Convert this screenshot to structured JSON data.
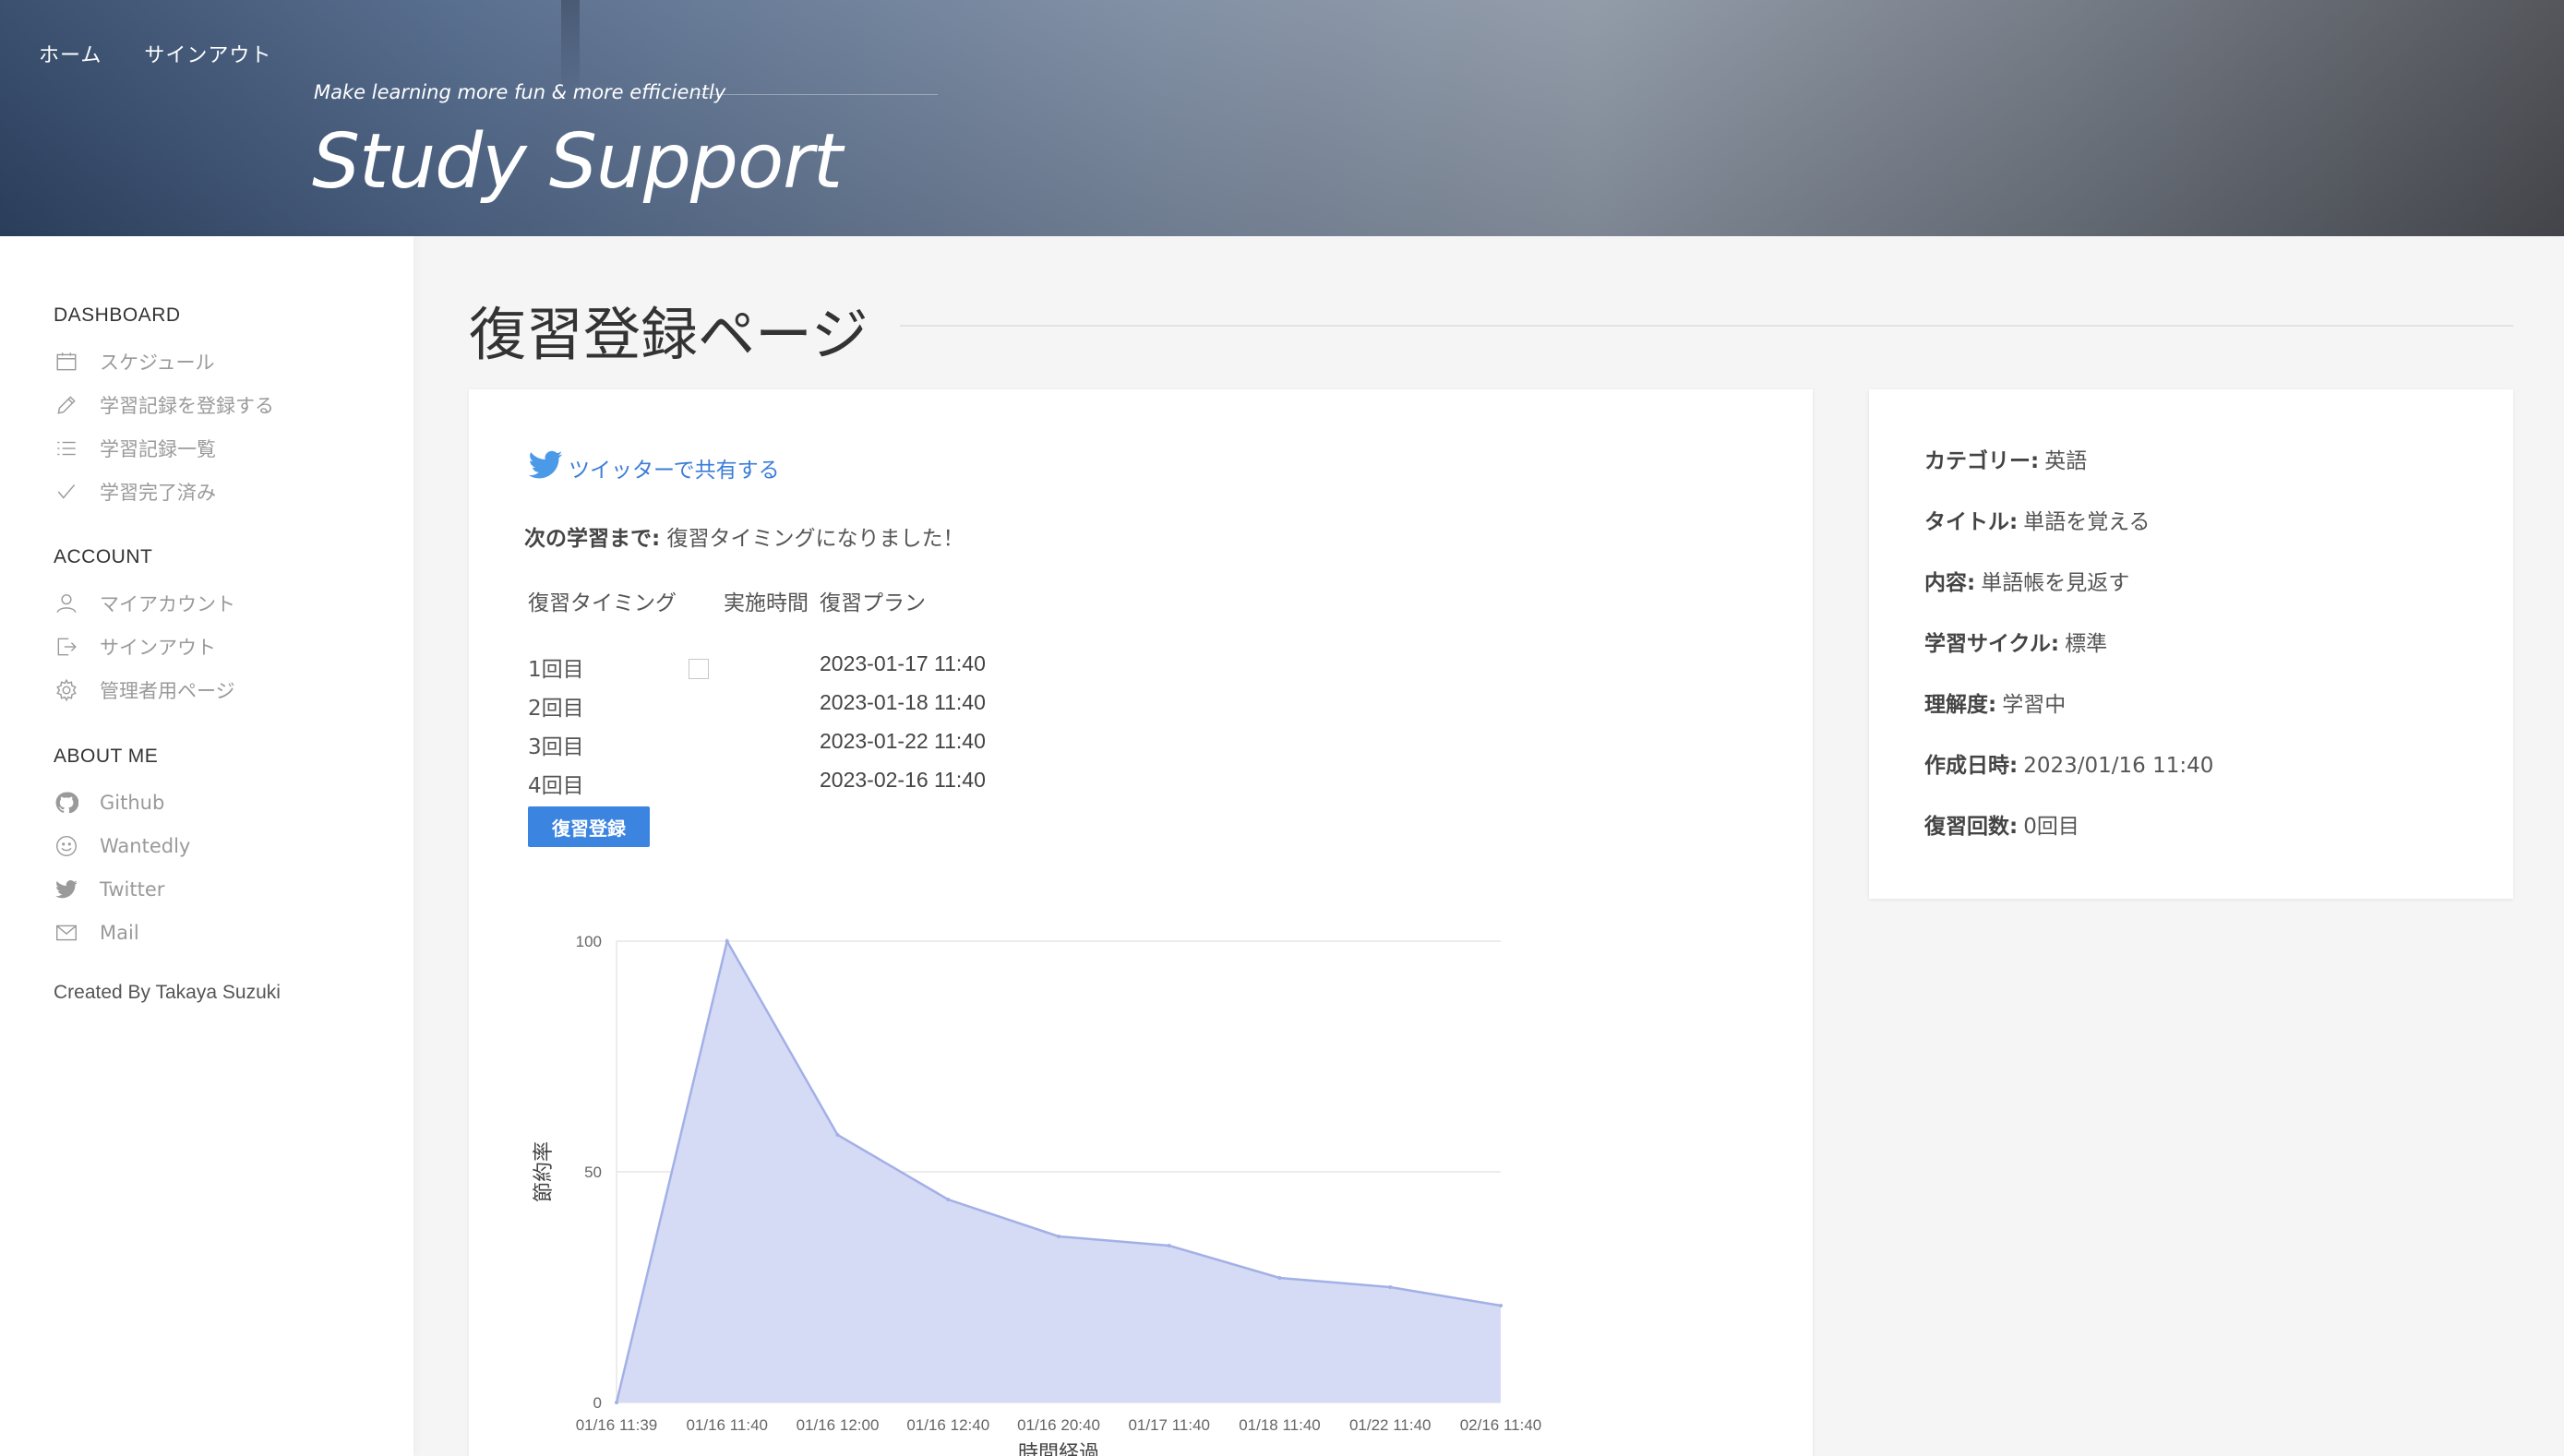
{
  "header": {
    "nav": [
      {
        "label": "ホーム"
      },
      {
        "label": "サインアウト"
      }
    ],
    "tagline": "Make learning more fun & more efficiently",
    "site_title": "Study Support"
  },
  "sidebar": {
    "sections": [
      {
        "heading": "DASHBOARD",
        "items": [
          {
            "label": "スケジュール",
            "icon": "calendar-icon"
          },
          {
            "label": "学習記録を登録する",
            "icon": "pencil-icon"
          },
          {
            "label": "学習記録一覧",
            "icon": "list-icon"
          },
          {
            "label": "学習完了済み",
            "icon": "check-icon"
          }
        ]
      },
      {
        "heading": "ACCOUNT",
        "items": [
          {
            "label": "マイアカウント",
            "icon": "user-icon"
          },
          {
            "label": "サインアウト",
            "icon": "signout-icon"
          },
          {
            "label": "管理者用ページ",
            "icon": "gear-icon"
          }
        ]
      },
      {
        "heading": "ABOUT ME",
        "items": [
          {
            "label": "Github",
            "icon": "github-icon"
          },
          {
            "label": "Wantedly",
            "icon": "smile-icon"
          },
          {
            "label": "Twitter",
            "icon": "twitter-icon"
          },
          {
            "label": "Mail",
            "icon": "mail-icon"
          }
        ]
      }
    ],
    "credit": "Created By Takaya Suzuki"
  },
  "main": {
    "page_title": "復習登録ページ",
    "share_label": "ツイッターで共有する",
    "next_study_label": "次の学習まで:",
    "next_study_value": "復習タイミングになりました！",
    "table": {
      "headers": [
        "復習タイミング",
        "実施時間",
        "復習プラン"
      ],
      "rows": [
        {
          "count": "1回目",
          "checked": false,
          "plan": "2023-01-17 11:40"
        },
        {
          "count": "2回目",
          "plan": "2023-01-18 11:40"
        },
        {
          "count": "3回目",
          "plan": "2023-01-22 11:40"
        },
        {
          "count": "4回目",
          "plan": "2023-02-16 11:40"
        }
      ]
    },
    "register_button": "復習登録"
  },
  "info": {
    "rows": [
      {
        "label": "カテゴリー:",
        "value": "英語"
      },
      {
        "label": "タイトル:",
        "value": "単語を覚える"
      },
      {
        "label": "内容:",
        "value": "単語帳を見返す"
      },
      {
        "label": "学習サイクル:",
        "value": "標準"
      },
      {
        "label": "理解度:",
        "value": "学習中"
      },
      {
        "label": "作成日時:",
        "value": "2023/01/16 11:40"
      },
      {
        "label": "復習回数:",
        "value": "0回目"
      }
    ]
  },
  "chart_data": {
    "type": "area",
    "categories": [
      "01/16 11:39",
      "01/16 11:40",
      "01/16 12:00",
      "01/16 12:40",
      "01/16 20:40",
      "01/17 11:40",
      "01/18 11:40",
      "01/22 11:40",
      "02/16 11:40"
    ],
    "values": [
      0,
      100,
      58,
      44,
      36,
      34,
      27,
      25,
      21
    ],
    "xlabel": "時間経過",
    "ylabel": "節約率",
    "ylim": [
      0,
      100
    ],
    "yticks": [
      0,
      50,
      100
    ],
    "grid": true,
    "fill_color": "#d5dbf5",
    "line_color": "#a3b0e6"
  },
  "colors": {
    "accent": "#3b84e0",
    "link": "#3b7dd8"
  }
}
